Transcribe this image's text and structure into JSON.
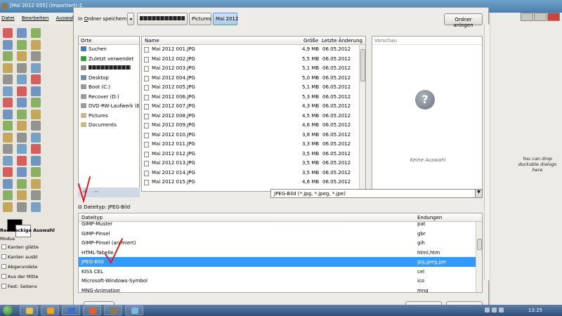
{
  "gimp": {
    "window_title": "[Mai 2012 055] (importiert)-2.",
    "menu": [
      "Datei",
      "Bearbeiten",
      "Auswahl"
    ],
    "tool_options_title": "Rechteckige Auswahl",
    "mode_label": "Modus",
    "opt_antialias": "Kanten glätte",
    "opt_feather": "Kanten ausbl",
    "opt_rounded": "Abgerundete",
    "opt_center": "Aus der Mitte",
    "opt_fixed": "Fest: Seitenv",
    "dock_hint": "You can drop dockable dialogs here"
  },
  "dialog": {
    "save_in_label": "In Ordner speichern:",
    "save_in_mnemonic": "O",
    "path": [
      "Pictures",
      "Mai 2012"
    ],
    "new_folder_button": "Ordner anlegen",
    "places_header": "Orte",
    "places": [
      {
        "label": "Suchen",
        "icon": "search-icon",
        "color": "#4a78b5"
      },
      {
        "label": "Zuletzt verwendet",
        "icon": "recent-icon",
        "color": "#3c9a3c"
      },
      {
        "label": "",
        "icon": "home-folder-icon",
        "color": "#8a8a8a",
        "redacted": true
      },
      {
        "label": "Desktop",
        "icon": "desktop-icon",
        "color": "#6f8bb0"
      },
      {
        "label": "Boot (C:)",
        "icon": "drive-icon",
        "color": "#9a9a9a"
      },
      {
        "label": "Recover (D:)",
        "icon": "drive-icon",
        "color": "#9a9a9a"
      },
      {
        "label": "DVD-RW-Laufwerk (E:)",
        "icon": "optical-drive-icon",
        "color": "#9a9a9a"
      },
      {
        "label": "Pictures",
        "icon": "folder-icon",
        "color": "#c7b98a"
      },
      {
        "label": "Documents",
        "icon": "folder-icon",
        "color": "#c7b98a"
      }
    ],
    "files_header": {
      "name": "Name",
      "size": "Größe",
      "modified": "Letzte Änderung"
    },
    "files": [
      {
        "name": "Mai 2012 001.JPG",
        "size": "4,9 MB",
        "date": "06.05.2012"
      },
      {
        "name": "Mai 2012 002.JPG",
        "size": "5,5 MB",
        "date": "06.05.2012"
      },
      {
        "name": "Mai 2012 003.JPG",
        "size": "5,1 MB",
        "date": "06.05.2012"
      },
      {
        "name": "Mai 2012 004.JPG",
        "size": "5,0 MB",
        "date": "06.05.2012"
      },
      {
        "name": "Mai 2012 005.JPG",
        "size": "5,1 MB",
        "date": "06.05.2012"
      },
      {
        "name": "Mai 2012 006.JPG",
        "size": "5,3 MB",
        "date": "06.05.2012"
      },
      {
        "name": "Mai 2012 007.JPG",
        "size": "4,3 MB",
        "date": "06.05.2012"
      },
      {
        "name": "Mai 2012 008.JPG",
        "size": "4,5 MB",
        "date": "06.05.2012"
      },
      {
        "name": "Mai 2012 009.JPG",
        "size": "4,6 MB",
        "date": "06.05.2012"
      },
      {
        "name": "Mai 2012 010.JPG",
        "size": "3,8 MB",
        "date": "06.05.2012"
      },
      {
        "name": "Mai 2012 011.JPG",
        "size": "3,3 MB",
        "date": "06.05.2012"
      },
      {
        "name": "Mai 2012 012.JPG",
        "size": "3,5 MB",
        "date": "06.05.2012"
      },
      {
        "name": "Mai 2012 013.JPG",
        "size": "3,5 MB",
        "date": "06.05.2012"
      },
      {
        "name": "Mai 2012 014.JPG",
        "size": "3,5 MB",
        "date": "06.05.2012"
      },
      {
        "name": "Mai 2012 015.JPG",
        "size": "4,6 MB",
        "date": "06.05.2012"
      }
    ],
    "preview_header": "Vorschau",
    "preview_empty": "Keine Auswahl",
    "add_button": "+",
    "remove_button": "−",
    "filter_value": "JPEG-Bild (*.jpg, *.jpeg, *.jpe)",
    "filetype_expander": "Dateityp: JPEG-Bild",
    "types_header": {
      "type": "Dateityp",
      "ext": "Endungen"
    },
    "types": [
      {
        "type": "GIMP-Muster",
        "ext": "pat"
      },
      {
        "type": "GIMP-Pinsel",
        "ext": "gbr"
      },
      {
        "type": "GIMP-Pinsel (animiert)",
        "ext": "gih"
      },
      {
        "type": "HTML-Tabelle",
        "ext": "html,htm"
      },
      {
        "type": "JPEG-Bild",
        "ext": "jpg,jpeg,jpe",
        "selected": true
      },
      {
        "type": "KISS CEL",
        "ext": "cel"
      },
      {
        "type": "Microsoft-Windows-Symbol",
        "ext": "ico"
      },
      {
        "type": "MNG-Animation",
        "ext": "mng"
      }
    ],
    "help_button": "Hilfe",
    "save_button": "Speichern",
    "cancel_button": "Abbrechen"
  },
  "taskbar": {
    "clock": "13:25",
    "apps": [
      {
        "icon": "explorer-icon",
        "color": "#e8c34a"
      },
      {
        "icon": "media-player-icon",
        "color": "#f1a02a"
      },
      {
        "icon": "word-icon",
        "color": "#3f6fc8"
      },
      {
        "icon": "firefox-icon",
        "color": "#e4622a"
      },
      {
        "icon": "gimp-icon",
        "color": "#8a7a55"
      },
      {
        "icon": "paint-icon",
        "color": "#7fb8e0"
      }
    ]
  },
  "colors": {
    "selection": "#3399ff",
    "annotation": "#e01b1b"
  }
}
